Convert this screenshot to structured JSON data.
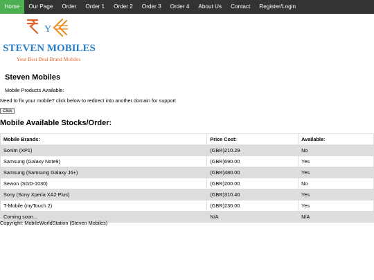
{
  "nav": {
    "items": [
      "Home",
      "Our Page",
      "Order",
      "Order 1",
      "Order 2",
      "Order 3",
      "Order 4",
      "About Us",
      "Contact",
      "Register/Login"
    ],
    "active": "Home",
    "bg_color": "#333333",
    "active_color": "#4CAF50"
  },
  "logo": {
    "symbol_text": "Y",
    "name": "STEVEN MOBILES",
    "tagline": "Your Best Deal Brand Mobiles",
    "name_color": "#2a7ec7",
    "tagline_color": "#e0612a",
    "icon": "rupee-yen-logo-icon"
  },
  "main": {
    "company_heading": "Steven Mobiles",
    "products_text": "Mobile Products Available:",
    "fix_text": "Need to fix your mobile? click below to redirect into another domain for support",
    "click_label": "Click",
    "stock_heading": "Mobile Available Stocks/Order:"
  },
  "table": {
    "headers": [
      "Mobile Brands:",
      "Price Cost:",
      "Available:"
    ],
    "rows": [
      [
        "Sonim (XP1)",
        "(GBR)210.29",
        "No"
      ],
      [
        "Samsung (Galaxy Note9)",
        "(GBR)690.00",
        "Yes"
      ],
      [
        "Samsung (Samsung Galaxy J6+)",
        "(GBR)480.00",
        "Yes"
      ],
      [
        "Sewon (SGD-1030)",
        "(GBR)200.00",
        "No"
      ],
      [
        "Sony (Sony Xperia XA2 Plus)",
        "(GBR)310.40",
        "Yes"
      ],
      [
        "T-Mobile (myTouch 2)",
        "(GBR)230.00",
        "Yes"
      ],
      [
        "Coming soon...",
        "N/A",
        "N/A"
      ]
    ]
  },
  "footer": {
    "copyright": "Copyright: MobileWorldStation (Steven Mobiles)"
  }
}
